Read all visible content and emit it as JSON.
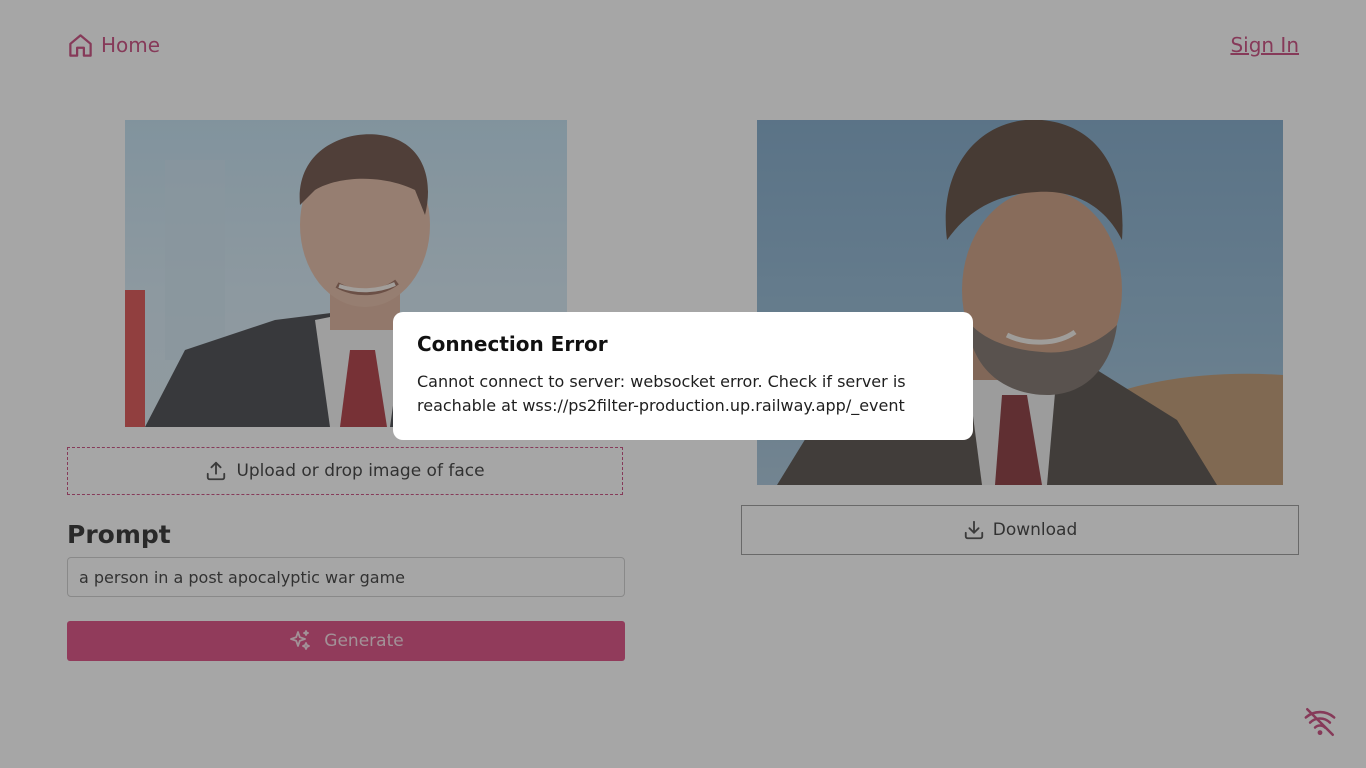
{
  "header": {
    "home_label": "Home",
    "home_icon": "home-icon",
    "sign_in_label": "Sign In"
  },
  "left": {
    "upload_label": "Upload or drop image of face",
    "upload_icon": "upload-icon",
    "prompt_heading": "Prompt",
    "prompt_value": "a person in a post apocalyptic war game",
    "generate_label": "Generate",
    "generate_icon": "sparkles-icon"
  },
  "right": {
    "download_label": "Download",
    "download_icon": "download-icon"
  },
  "status": {
    "connection_icon": "wifi-off-icon"
  },
  "dialog": {
    "title": "Connection Error",
    "message": "Cannot connect to server: websocket error. Check if server is reachable at wss://ps2filter-production.up.railway.app/_event"
  },
  "colors": {
    "accent": "#c2306b",
    "button_bg": "#d7336f",
    "overlay": "#464646"
  }
}
